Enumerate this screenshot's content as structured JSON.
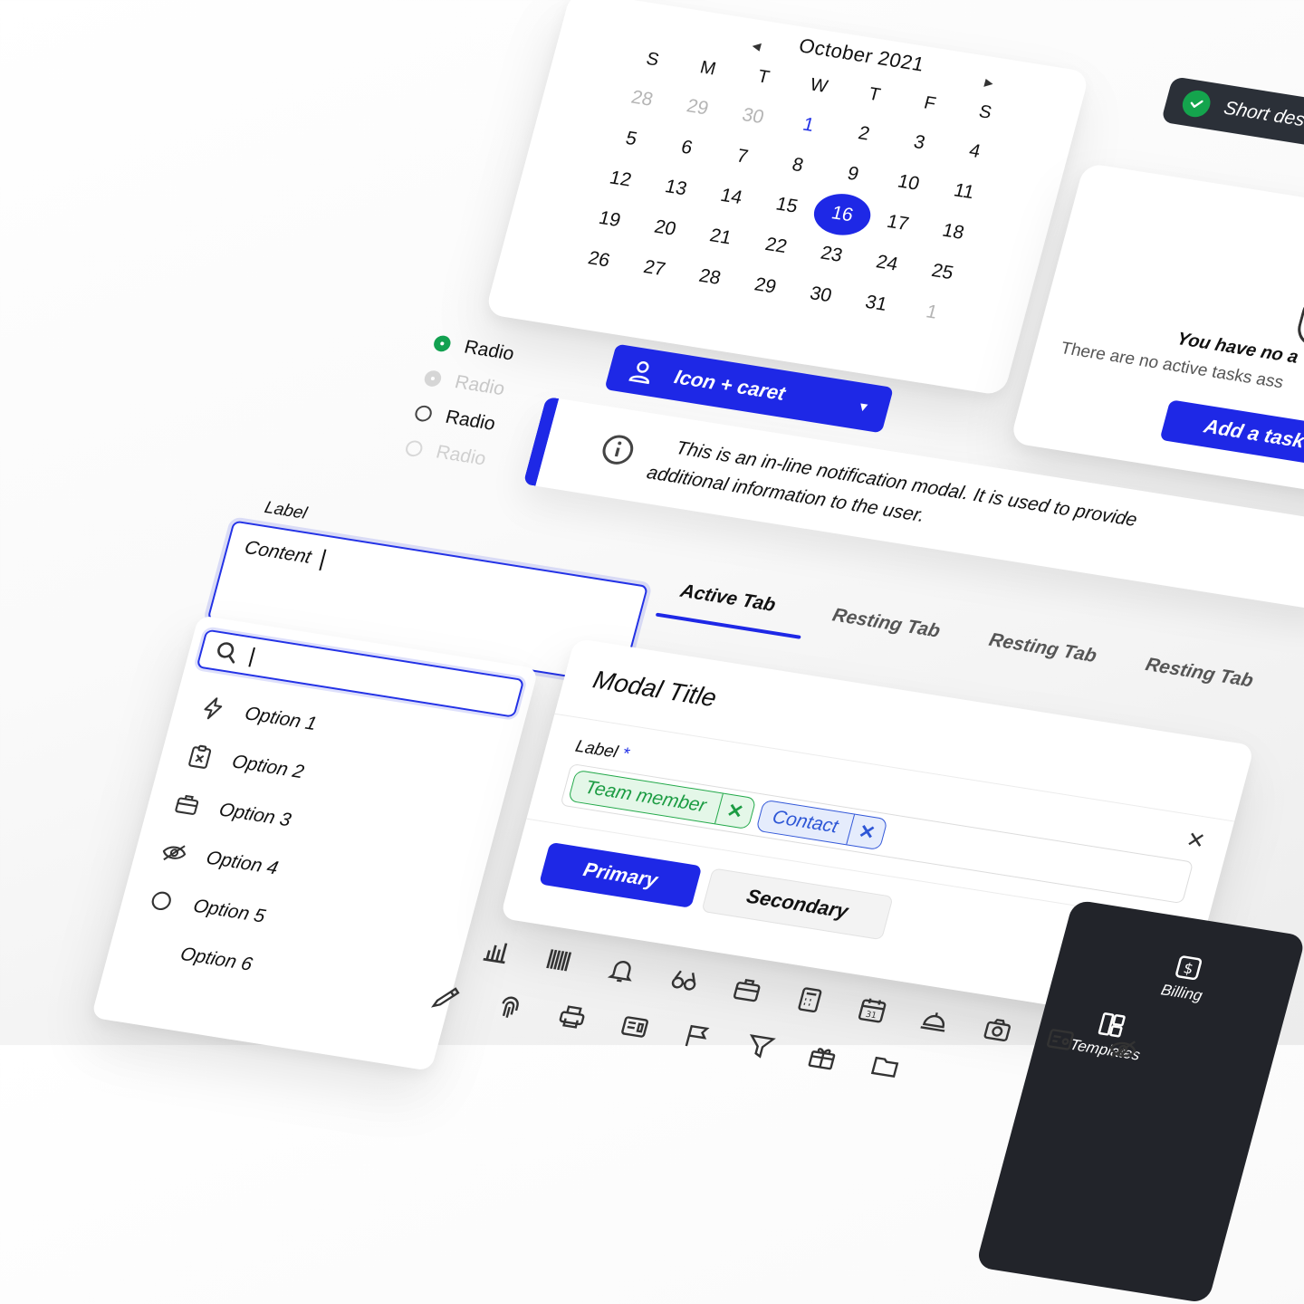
{
  "calendar": {
    "month_label": "October 2021",
    "prev_arrow": "◀",
    "next_arrow": "▶",
    "weekdays": [
      "S",
      "M",
      "T",
      "W",
      "T",
      "F",
      "S"
    ],
    "weeks": [
      [
        "28",
        "29",
        "30",
        "1",
        "2",
        "3",
        "4"
      ],
      [
        "5",
        "6",
        "7",
        "8",
        "9",
        "10",
        "11"
      ],
      [
        "12",
        "13",
        "14",
        "15",
        "16",
        "17",
        "18"
      ],
      [
        "19",
        "20",
        "21",
        "22",
        "23",
        "24",
        "25"
      ],
      [
        "26",
        "27",
        "28",
        "29",
        "30",
        "31",
        "1"
      ]
    ],
    "selected_day": "16",
    "accent": "#1e28e6"
  },
  "toast": {
    "text": "Short des"
  },
  "empty_state": {
    "title": "You have no a",
    "subtitle": "There are no active tasks ass",
    "button": "Add a task"
  },
  "radios": [
    {
      "label": "Radio",
      "state": "selected"
    },
    {
      "label": "Radio",
      "state": "disabled-selected"
    },
    {
      "label": "Radio",
      "state": "unselected"
    },
    {
      "label": "Radio",
      "state": "disabled"
    }
  ],
  "icon_caret_button": {
    "label": "Icon + caret"
  },
  "notification": {
    "line1": "This is an in-line notification modal. It is used to provide",
    "line2": "additional information to the user."
  },
  "textarea": {
    "label": "Label",
    "value": "Content"
  },
  "tabs": [
    {
      "label": "Active Tab",
      "active": true
    },
    {
      "label": "Resting Tab",
      "active": false
    },
    {
      "label": "Resting Tab",
      "active": false
    },
    {
      "label": "Resting Tab",
      "active": false
    }
  ],
  "search": {
    "value": ""
  },
  "menu": [
    {
      "label": "Option 1",
      "icon": "lightning-icon"
    },
    {
      "label": "Option 2",
      "icon": "clipboard-x-icon"
    },
    {
      "label": "Option 3",
      "icon": "briefcase-icon"
    },
    {
      "label": "Option 4",
      "icon": "eye-off-icon"
    },
    {
      "label": "Option 5",
      "icon": "circle-icon"
    },
    {
      "label": "Option 6",
      "icon": ""
    }
  ],
  "modal": {
    "title": "Modal Title",
    "field_label": "Label",
    "required_mark": "*",
    "chips": [
      {
        "label": "Team member",
        "style": "green"
      },
      {
        "label": "Contact",
        "style": "blue"
      }
    ],
    "primary_button": "Primary",
    "secondary_button": "Secondary",
    "toggle_on": true
  },
  "sidebar": {
    "items": [
      {
        "label": "Billing",
        "icon": "billing-icon"
      },
      {
        "label": "Templates",
        "icon": "templates-icon"
      }
    ]
  },
  "icon_grid": {
    "row1": [
      "bar-chart-icon",
      "barcode-icon",
      "bell-icon",
      "binoculars-icon",
      "briefcase-icon",
      "calculator-icon",
      "calendar-icon",
      "service-bell-icon",
      "camera-icon",
      "id-card-icon",
      "eye-off-icon"
    ],
    "row2": [
      "eyedropper-icon",
      "fingerprint-icon",
      "printer-icon",
      "newspaper-icon",
      "flag-icon",
      "filter-icon",
      "gift-icon",
      "folder-icon"
    ]
  }
}
